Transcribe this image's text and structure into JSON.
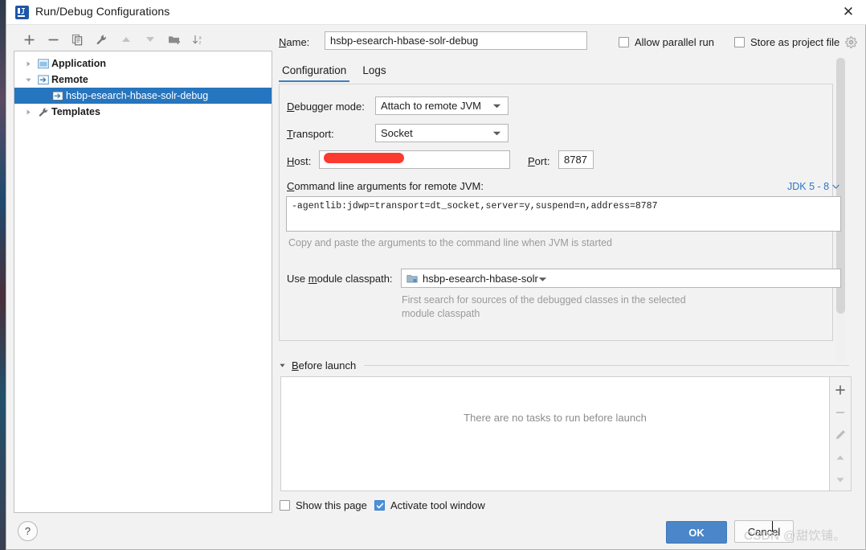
{
  "window": {
    "title": "Run/Debug Configurations",
    "app_icon": "intellij-idea-icon",
    "close_label": "✕"
  },
  "left_toolbar": {
    "buttons": [
      {
        "name": "add-configuration-button",
        "icon": "plus-icon",
        "label": "+"
      },
      {
        "name": "remove-configuration-button",
        "icon": "minus-icon",
        "label": "−"
      },
      {
        "name": "copy-configuration-button",
        "icon": "copy-icon",
        "label": "Copy"
      },
      {
        "name": "edit-templates-button",
        "icon": "wrench-icon",
        "label": "Edit Templates"
      },
      {
        "name": "move-up-button",
        "icon": "arrow-up-icon",
        "label": "Move Up"
      },
      {
        "name": "move-down-button",
        "icon": "arrow-down-icon",
        "label": "Move Down"
      },
      {
        "name": "move-into-folder-button",
        "icon": "folder-add-icon",
        "label": "Create Folder"
      },
      {
        "name": "sort-configurations-button",
        "icon": "sort-alpha-icon",
        "label": "Sort Configurations"
      }
    ]
  },
  "tree": {
    "items": [
      {
        "label": "Application",
        "icon": "application-icon",
        "expanded": false,
        "selected": false,
        "level": 0
      },
      {
        "label": "Remote",
        "icon": "remote-icon",
        "expanded": true,
        "selected": false,
        "level": 0
      },
      {
        "label": "hsbp-esearch-hbase-solr-debug",
        "icon": "remote-icon",
        "expanded": null,
        "selected": true,
        "level": 1
      },
      {
        "label": "Templates",
        "icon": "wrench-icon",
        "expanded": false,
        "selected": false,
        "level": 0
      }
    ]
  },
  "help_button": {
    "label": "?",
    "name": "help-button"
  },
  "header": {
    "name_label": "Name:",
    "name_value": "hsbp-esearch-hbase-solr-debug",
    "allow_parallel_run": {
      "label": "Allow parallel run",
      "checked": false
    },
    "store_as_project_file": {
      "label": "Store as project file",
      "checked": false
    },
    "gear_icon": "gear-icon"
  },
  "tabs": [
    {
      "label": "Configuration",
      "active": true
    },
    {
      "label": "Logs",
      "active": false
    }
  ],
  "configuration": {
    "debugger_mode": {
      "label": "Debugger mode:",
      "value": "Attach to remote JVM"
    },
    "transport": {
      "label": "Transport:",
      "value": "Socket"
    },
    "host": {
      "label": "Host:",
      "value": "",
      "redacted": true
    },
    "port": {
      "label": "Port:",
      "value": "8787"
    },
    "command_line": {
      "label": "Command line arguments for remote JVM:",
      "value": "-agentlib:jdwp=transport=dt_socket,server=y,suspend=n,address=8787",
      "jdk_selector": "JDK 5 - 8",
      "hint": "Copy and paste the arguments to the command line when JVM is started"
    },
    "module_classpath": {
      "label": "Use module classpath:",
      "value": "hsbp-esearch-hbase-solr",
      "icon": "module-icon",
      "hint_line1": "First search for sources of the debugged classes in the selected",
      "hint_line2": "module classpath"
    }
  },
  "before_launch": {
    "title": "Before launch",
    "expanded": true,
    "empty_message": "There are no tasks to run before launch",
    "side_buttons": [
      {
        "name": "before-launch-add-button",
        "icon": "plus-icon"
      },
      {
        "name": "before-launch-remove-button",
        "icon": "minus-icon"
      },
      {
        "name": "before-launch-edit-button",
        "icon": "pencil-icon"
      },
      {
        "name": "before-launch-move-up-button",
        "icon": "arrow-up-icon"
      },
      {
        "name": "before-launch-move-down-button",
        "icon": "arrow-down-icon"
      }
    ]
  },
  "footer": {
    "show_this_page": {
      "label": "Show this page",
      "checked": false
    },
    "activate_tool_window": {
      "label": "Activate tool window",
      "checked": true
    },
    "ok_label": "OK",
    "cancel_label": "Cancel"
  },
  "watermark": "CSDN @甜饮铺。",
  "colors": {
    "accent": "#4a86c8",
    "selection": "#2675bf",
    "link": "#2e75c4",
    "redaction": "#fb3b30",
    "checkbox_checked": "#4a91de"
  }
}
